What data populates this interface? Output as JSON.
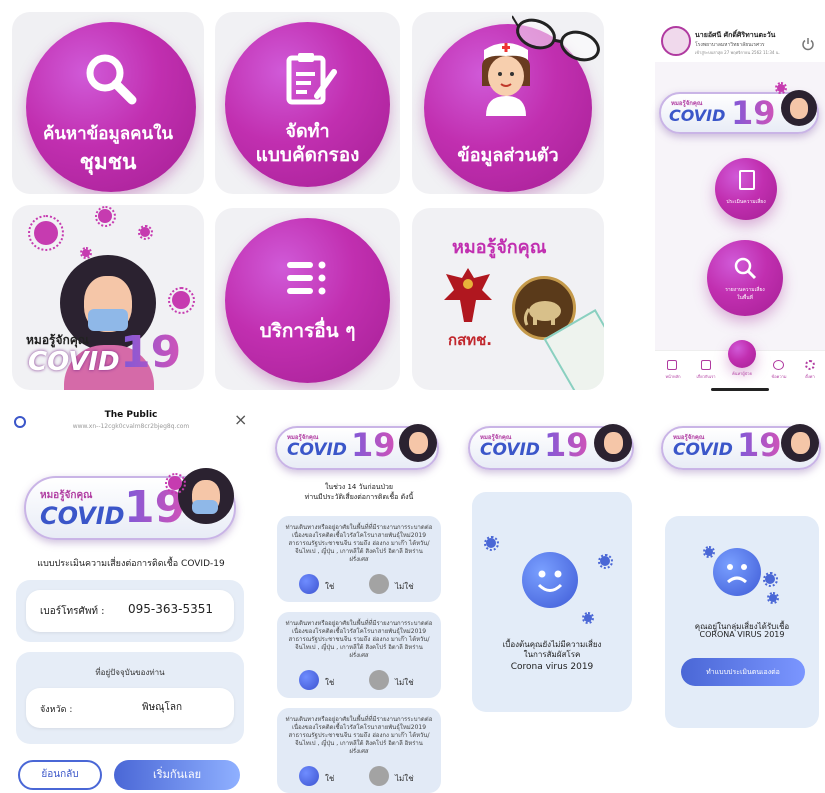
{
  "menu": {
    "search_label_1": "ค้นหาข้อมูลคนใน",
    "search_label_2": "ชุมชน",
    "screening_label_1": "จัดทำ",
    "screening_label_2": "แบบคัดกรอง",
    "profile_label": "ข้อมูลส่วนตัว",
    "services_label": "บริการอื่น ๆ",
    "doctor_title": "หมอรู้จักคุณ",
    "org_logo_text": "กสทช."
  },
  "brand": {
    "small": "หมอรู้จักคุณ",
    "covid": "COVID",
    "number": "19"
  },
  "phone_home": {
    "user_name": "นายอัศนี ศักดิ์ศิริทานตะวัน",
    "hospital": "โรงพยาบาลมหาวิทยาลัยนเรศวร",
    "last_login": "เข้าสู่ระบบล่าสุด 27 พฤศจิกายน 2562 11:34 น.",
    "risk_btn": "ประเมินความเสี่ยง",
    "report_btn_1": "รายงานความเสี่ยง",
    "report_btn_2": "ในพื้นที่",
    "nav": [
      "หน้าหลัก",
      "เกี่ยวกับเรา",
      "ค้นหาผู้ป่วย",
      "ข้อความ",
      "ตั้งค่า"
    ]
  },
  "form": {
    "site_title": "The Public",
    "site_url": "www.xn--12cgk0cvalm8cr2bjeg8q.com",
    "heading": "แบบประเมินความเสี่ยงต่อการติดเชื้อ COVID-19",
    "phone_label": "เบอร์โทรศัพท์ :",
    "phone_value": "095-363-5351",
    "location_heading": "ที่อยู่ปัจจุบันของท่าน",
    "province_label": "จังหวัด :",
    "province_value": "พิษณุโลก",
    "back_btn": "ย้อนกลับ",
    "start_btn": "เริ่มกันเลย"
  },
  "questionnaire": {
    "heading_1": "ในช่วง 14 วันก่อนป่วย",
    "heading_2": "ท่านมีประวัติเสี่ยงต่อการติดเชื้อ ดังนี้",
    "question": "ท่านเดินทางหรืออยู่อาศัยในพื้นที่ที่มีรายงานการระบาดต่อเนื่องของโรคติดเชื้อไวรัสโคโรนาสายพันธุ์ใหม่2019 สาธารณรัฐประชาชนจีน รวมถึง ฮ่องกง มาเก๊า ไต้หวัน/จีนไทเป , ญี่ปุ่น , เกาหลีใต้ สิงคโปร์ อิตาลี อิหร่าน ฝรั่งเศส",
    "yes": "ใช่",
    "no": "ไม่ใช่"
  },
  "result_low": {
    "line_1": "เบื้องต้นคุณยังไม่มีความเสี่ยง",
    "line_2": "ในการสัมผัสโรค",
    "line_3": "Corona virus 2019"
  },
  "result_high": {
    "line_1": "คุณอยู่ในกลุ่มเสี่ยงได้รับเชื้อ",
    "line_2": "CORONA VIRUS 2019",
    "button": "ทำแบบประเมินตนเองต่อ"
  },
  "colors": {
    "magenta": "#c12fb0",
    "blue": "#3b56c9",
    "panel": "#e6edf7"
  }
}
